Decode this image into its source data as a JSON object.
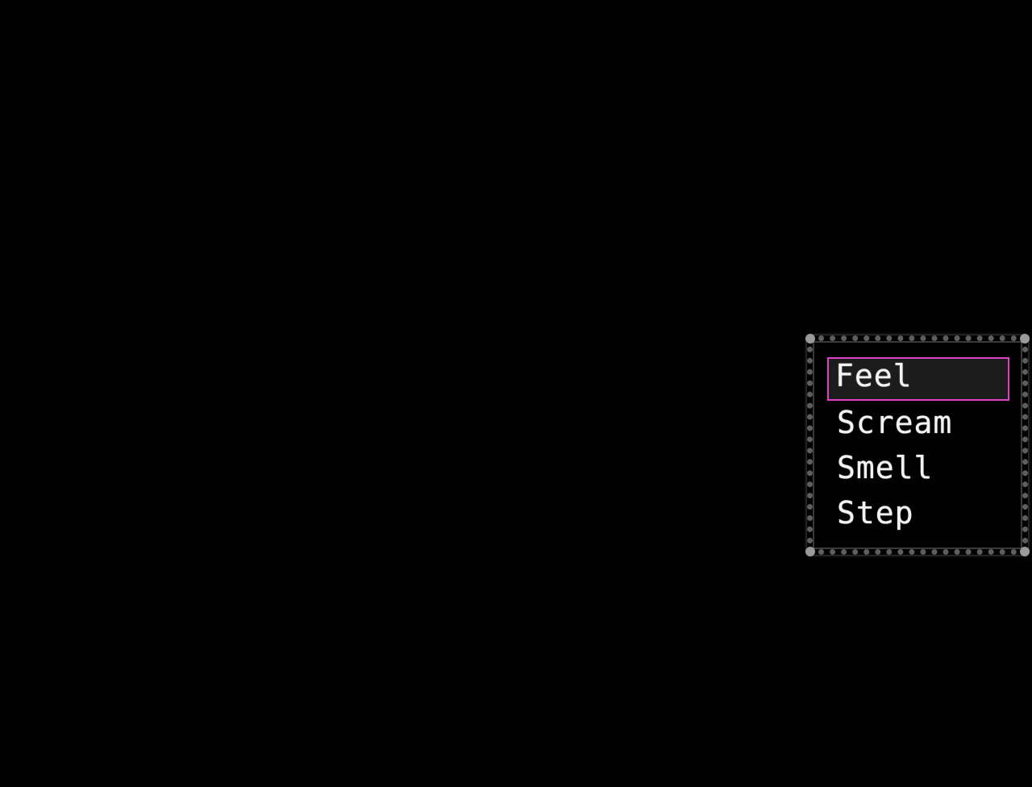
{
  "menu": {
    "options": [
      {
        "label": "Feel",
        "selected": true
      },
      {
        "label": "Scream",
        "selected": false
      },
      {
        "label": "Smell",
        "selected": false
      },
      {
        "label": "Step",
        "selected": false
      }
    ]
  },
  "colors": {
    "background": "#000000",
    "menu_border": "#5e5e5e",
    "selection_outline": "#e040c8",
    "text": "#f2f2f2"
  }
}
